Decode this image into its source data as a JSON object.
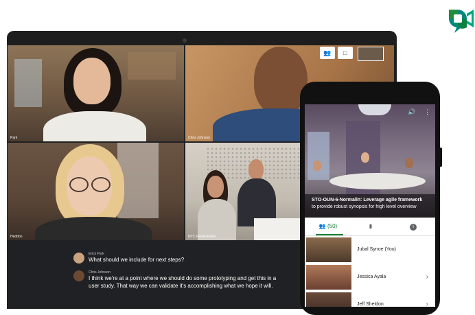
{
  "laptop": {
    "participants": [
      {
        "name": "Park"
      },
      {
        "name": "Chris Johnson"
      },
      {
        "name": "Heddon"
      },
      {
        "name": "NYC Fenwickstein"
      }
    ],
    "controls": {
      "people_icon": "people-icon",
      "chat_icon": "chat-icon"
    }
  },
  "captions": [
    {
      "speaker": "Erick Park",
      "text": "What should we include for next steps?"
    },
    {
      "speaker": "Chris Johnson",
      "text_line1": "I think we're at a point where we should do some prototyping and get this in a",
      "text_line2": "user study. That way we can validate it's accomplishing what we hope it will."
    }
  ],
  "phone": {
    "meeting_title_line1": "STO-OUN-6-Normalin: Leverage agile framework",
    "meeting_title_line2": "to provide robust synopsis for high level overview",
    "tabs": {
      "people_count": "(50)",
      "people_icon": "people-icon",
      "chat_icon": "chat-icon",
      "info_icon": "info-icon"
    },
    "participants": [
      {
        "label": "Jubal Synoe (You)"
      },
      {
        "label": "Jessica Ayala"
      },
      {
        "label": "Jeff Sheldon"
      }
    ]
  },
  "colors": {
    "meet_green": "#188038",
    "meet_yellow": "#fbbc04",
    "meet_blue": "#1a73e8",
    "dark_bg": "#202124"
  }
}
